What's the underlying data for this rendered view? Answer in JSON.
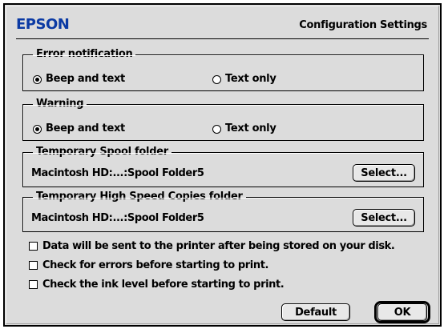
{
  "header": {
    "logo_text": "EPSON",
    "title": "Configuration Settings",
    "logo_color": "#0b3aa4"
  },
  "error_notification": {
    "legend": "Error notification",
    "options": [
      {
        "label": "Beep and text",
        "selected": true
      },
      {
        "label": "Text only",
        "selected": false
      }
    ]
  },
  "warning": {
    "legend": "Warning",
    "options": [
      {
        "label": "Beep and text",
        "selected": true
      },
      {
        "label": "Text only",
        "selected": false
      }
    ]
  },
  "spool_folder": {
    "legend": "Temporary Spool folder",
    "path": "Macintosh HD:...:Spool Folder5",
    "button_label": "Select..."
  },
  "high_speed_folder": {
    "legend": "Temporary High Speed Copies folder",
    "path": "Macintosh HD:...:Spool Folder5",
    "button_label": "Select..."
  },
  "checkboxes": [
    {
      "label": "Data will be sent to the printer after being stored on your disk.",
      "checked": false
    },
    {
      "label": "Check for errors before starting to print.",
      "checked": false
    },
    {
      "label": "Check the ink level before starting to print.",
      "checked": false
    }
  ],
  "footer": {
    "default_label": "Default",
    "ok_label": "OK"
  }
}
